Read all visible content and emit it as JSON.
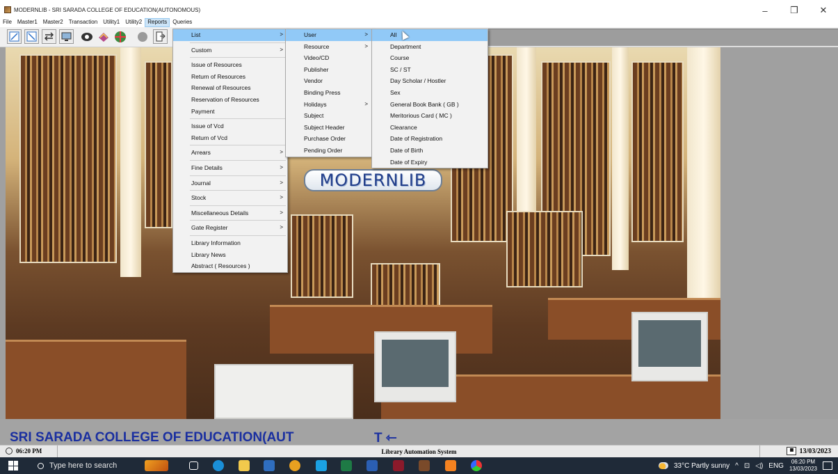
{
  "window": {
    "title": "MODERNLIB - SRI SARADA COLLEGE OF EDUCATION(AUTONOMOUS)",
    "controls": [
      "–",
      "❐",
      "✕"
    ]
  },
  "menubar": {
    "items": [
      "File",
      "Master1",
      "Master2",
      "Transaction",
      "Utility1",
      "Utility2",
      "Reports",
      "Queries"
    ],
    "active": "Reports"
  },
  "toolbar": {
    "icons": [
      "resize-icon",
      "shrink-icon",
      "swap-icon",
      "display-icon",
      "eye-icon",
      "books-icon",
      "globe-icon",
      "chat-icon",
      "exit-icon"
    ]
  },
  "logo": "MODERNLIB",
  "reports_menu": {
    "items": [
      {
        "label": "List",
        "submenu": true,
        "highlighted": true
      },
      {
        "sep": true
      },
      {
        "label": "Custom",
        "submenu": true
      },
      {
        "sep": true
      },
      {
        "label": "Issue of Resources"
      },
      {
        "label": "Return of Resources"
      },
      {
        "label": "Renewal of Resources"
      },
      {
        "label": "Reservation of Resources"
      },
      {
        "label": "Payment"
      },
      {
        "sep": true
      },
      {
        "label": "Issue of Vcd"
      },
      {
        "label": "Return of Vcd"
      },
      {
        "sep": true
      },
      {
        "label": "Arrears",
        "submenu": true
      },
      {
        "sep": true
      },
      {
        "label": "Fine Details",
        "submenu": true
      },
      {
        "sep": true
      },
      {
        "label": "Journal",
        "submenu": true
      },
      {
        "sep": true
      },
      {
        "label": "Stock",
        "submenu": true
      },
      {
        "sep": true
      },
      {
        "label": "Miscellaneous Details",
        "submenu": true
      },
      {
        "sep": true
      },
      {
        "label": "Gate Register",
        "submenu": true
      },
      {
        "sep": true
      },
      {
        "label": "Library Information"
      },
      {
        "label": "Library News"
      },
      {
        "label": "Abstract ( Resources )"
      }
    ]
  },
  "list_menu": {
    "items": [
      {
        "label": "User",
        "submenu": true,
        "highlighted": true
      },
      {
        "label": "Resource",
        "submenu": true
      },
      {
        "label": "Video/CD"
      },
      {
        "label": "Publisher"
      },
      {
        "label": "Vendor"
      },
      {
        "label": "Binding Press"
      },
      {
        "label": "Holidays",
        "submenu": true
      },
      {
        "label": "Subject"
      },
      {
        "label": "Subject Header"
      },
      {
        "label": "Purchase Order"
      },
      {
        "label": "Pending Order"
      }
    ]
  },
  "user_menu": {
    "items": [
      {
        "label": "All",
        "highlighted": true
      },
      {
        "label": "Department"
      },
      {
        "label": "Course"
      },
      {
        "label": "SC / ST"
      },
      {
        "label": "Day Scholar / Hostler"
      },
      {
        "label": "Sex"
      },
      {
        "label": "General Book Bank ( GB )"
      },
      {
        "label": "Meritorious Card ( MC )"
      },
      {
        "label": "Clearance"
      },
      {
        "label": "Date of Registration"
      },
      {
        "label": "Date of Birth"
      },
      {
        "label": "Date of Expiry"
      }
    ]
  },
  "college_bar": {
    "name": "SRI SARADA COLLEGE OF EDUCATION(AUT",
    "marker": "T ⇽"
  },
  "statusbar": {
    "time": "06:20 PM",
    "system": "Library Automation System",
    "date": "13/03/2023"
  },
  "taskbar": {
    "search_placeholder": "Type here to search",
    "weather": "33°C  Partly sunny",
    "lang": "ENG",
    "time": "06:20 PM",
    "date": "13/03/2023"
  }
}
